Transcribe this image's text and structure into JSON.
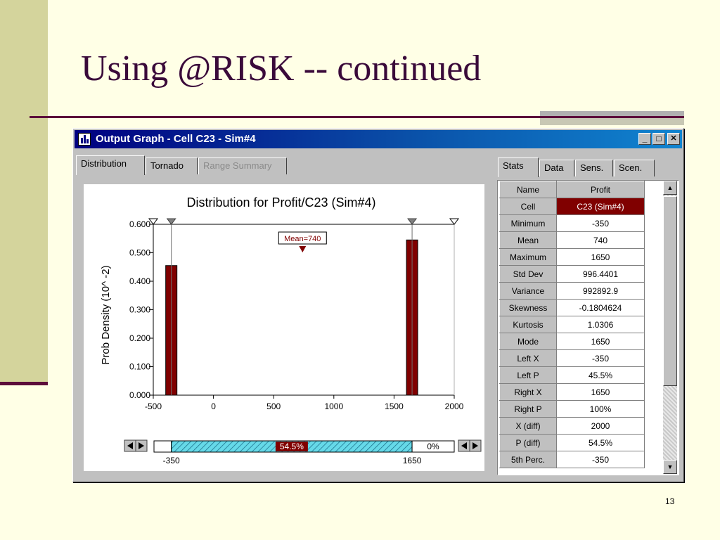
{
  "slide": {
    "title": "Using @RISK -- continued",
    "page_number": "13"
  },
  "window": {
    "title": "Output Graph - Cell C23 - Sim#4",
    "minimize": "_",
    "maximize": "□",
    "close": "✕"
  },
  "left_tabs": [
    "Distribution",
    "Tornado",
    "Range Summary"
  ],
  "right_tabs": [
    "Stats",
    "Data",
    "Sens.",
    "Scen."
  ],
  "chart_data": {
    "type": "bar",
    "title": "Distribution for Profit/C23 (Sim#4)",
    "xlabel": "",
    "ylabel": "Prob Density (10^ -2)",
    "xlim": [
      -500,
      2000
    ],
    "ylim": [
      0,
      0.6
    ],
    "x_ticks": [
      "-500",
      "0",
      "500",
      "1000",
      "1500",
      "2000"
    ],
    "y_ticks": [
      "0.000",
      "0.100",
      "0.200",
      "0.300",
      "0.400",
      "0.500",
      "0.600"
    ],
    "bars": [
      {
        "x": -350,
        "value": 0.455
      },
      {
        "x": 1650,
        "value": 0.545
      }
    ],
    "bar_color": "#800000",
    "mean_label": "Mean=740",
    "mean_value": 740,
    "left_marker": -350,
    "right_marker": 1650,
    "range_bar": {
      "left_pct": "",
      "middle_pct": "54.5%",
      "right_pct": "0%",
      "left_value": "-350",
      "right_value": "1650"
    }
  },
  "stats": {
    "header": {
      "label": "Name",
      "value": "Profit"
    },
    "rows": [
      {
        "label": "Cell",
        "value": "C23 (Sim#4)"
      },
      {
        "label": "Minimum",
        "value": "-350"
      },
      {
        "label": "Mean",
        "value": "740"
      },
      {
        "label": "Maximum",
        "value": "1650"
      },
      {
        "label": "Std Dev",
        "value": "996.4401"
      },
      {
        "label": "Variance",
        "value": "992892.9"
      },
      {
        "label": "Skewness",
        "value": "-0.1804624"
      },
      {
        "label": "Kurtosis",
        "value": "1.0306"
      },
      {
        "label": "Mode",
        "value": "1650"
      },
      {
        "label": "Left X",
        "value": "-350"
      },
      {
        "label": "Left P",
        "value": "45.5%"
      },
      {
        "label": "Right X",
        "value": "1650"
      },
      {
        "label": "Right P",
        "value": "100%"
      },
      {
        "label": "X (diff)",
        "value": "2000"
      },
      {
        "label": "P (diff)",
        "value": "54.5%"
      },
      {
        "label": "5th Perc.",
        "value": "-350"
      }
    ]
  }
}
